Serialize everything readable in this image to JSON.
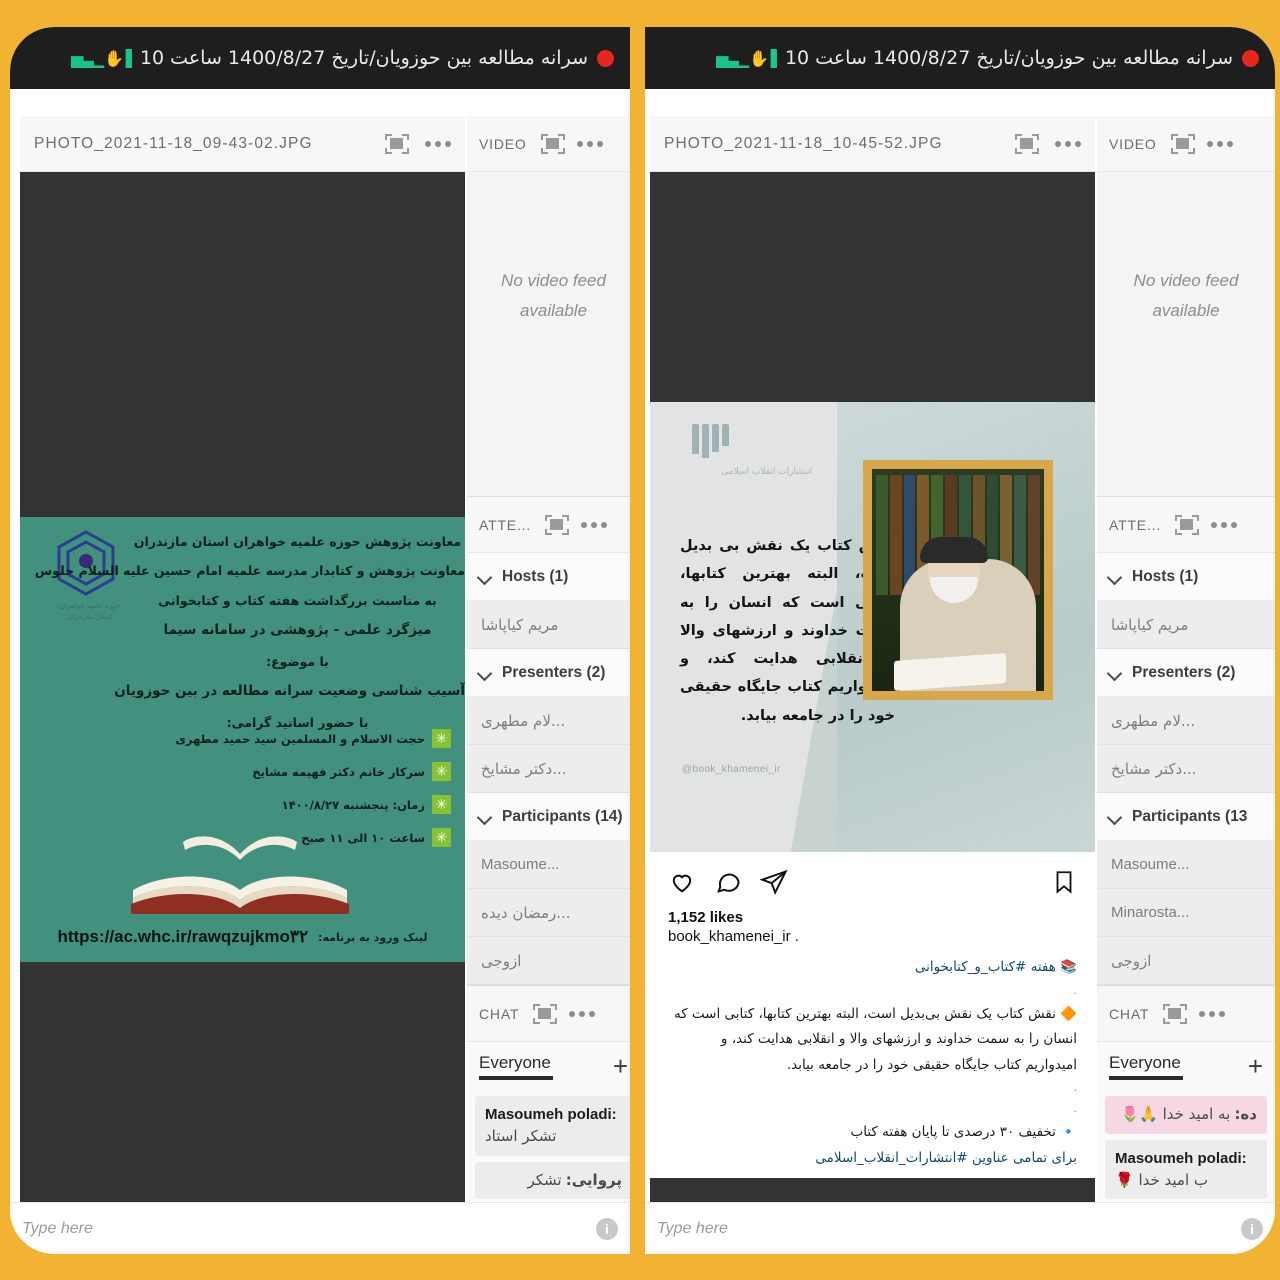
{
  "frame": {
    "border_color": "#f2b332"
  },
  "panels": [
    {
      "id": "left",
      "topbar": {
        "recording": true,
        "title": "سرانه مطالعه بین حوزویان/تاریخ 1400/8/27 ساعت 10"
      },
      "share_pod": {
        "title": "PHOTO_2021-11-18_09-43-02.JPG"
      },
      "video_pod": {
        "title": "VIDEO",
        "empty_message_line1": "No video feed",
        "empty_message_line2": "available"
      },
      "attendees_pod": {
        "title": "ATTE...",
        "groups": [
          {
            "label": "Hosts (1)",
            "members": [
              "مریم کیاپاشا"
            ]
          },
          {
            "label": "Presenters (2)",
            "members": [
              "...لام مطهری",
              "...دکتر مشایخ"
            ]
          },
          {
            "label": "Participants (14)",
            "members": [
              "Masoume...",
              "...رمضان دیده",
              "ازوجی"
            ]
          }
        ]
      },
      "chat_pod": {
        "title": "CHAT",
        "tab": "Everyone",
        "add_label": "+",
        "messages": [
          {
            "author": "Masoumeh poladi:",
            "text": "تشکر استاد",
            "highlight": false
          },
          {
            "author": "پروایی:",
            "text": "تشکر",
            "highlight": false
          }
        ],
        "composer_placeholder": "Type here",
        "composer_badge": "i"
      },
      "poster": {
        "type": "green-flyer",
        "lines": [
          "معاونت پژوهش حوزه علمیه خواهران استان مازندران",
          "معاونت پژوهش و کتابدار مدرسه علمیه امام حسین علیه السلام جلوس",
          "به مناسبت بزرگداشت هفته کتاب و کتابخوانی",
          "میزگرد علمی - پژوهشی در سامانه سیما",
          "با موضوع:",
          "آسیب شناسی وضعیت سرانه مطالعه در بین حوزویان",
          "با حضور اساتید گرامی:"
        ],
        "bullets": [
          "حجت الاسلام و المسلمین سید حمید مطهری",
          "سرکار خانم دکتر فهیمه مشایخ",
          "زمان: پنجشنبه ۱۴۰۰/۸/۲۷",
          "ساعت ۱۰ الی ۱۱ صبح"
        ],
        "footer_label": "لینک ورود به برنامه:",
        "url": "https://ac.whc.ir/rawqzujkmo۳۲"
      }
    },
    {
      "id": "right",
      "topbar": {
        "recording": true,
        "title": "سرانه مطالعه بین حوزویان/تاریخ 1400/8/27 ساعت 10"
      },
      "share_pod": {
        "title": "PHOTO_2021-11-18_10-45-52.JPG"
      },
      "video_pod": {
        "title": "VIDEO",
        "empty_message_line1": "No video feed",
        "empty_message_line2": "available"
      },
      "attendees_pod": {
        "title": "ATTE...",
        "groups": [
          {
            "label": "Hosts (1)",
            "members": [
              "مریم کیاپاشا"
            ]
          },
          {
            "label": "Presenters (2)",
            "members": [
              "...لام مطهری",
              "...دکتر مشایخ"
            ]
          },
          {
            "label": "Participants (13",
            "members": [
              "Masoume...",
              "Minarosta...",
              "ازوجی"
            ]
          }
        ]
      },
      "chat_pod": {
        "title": "CHAT",
        "tab": "Everyone",
        "add_label": "+",
        "messages": [
          {
            "author": "ده:",
            "text": "به امید خدا 🙏🌷",
            "highlight": true
          },
          {
            "author": "Masoumeh poladi:",
            "text": "ب امید خدا 🌹",
            "highlight": false
          }
        ],
        "composer_placeholder": "Type here",
        "composer_badge": "i"
      },
      "instagram": {
        "poster_quote": "نقش کتاب یک نقش بی بدیل است، البته بهترین کتابها، کتابی است که انسان را به سمت خداوند و ارزشهای والا و انقلابی هدایت کند، و امیدواریم کتاب جایگاه حقیقی خود را در جامعه بیابد.",
        "poster_handle": "@book_khamenei_ir",
        "likes": "1,152 likes",
        "username": "book_khamenei_ir",
        "username_suffix": ".",
        "caption_tag_line": "📚 هفته #کتاب_و_کتابخوانی",
        "caption_body": "🔶 نقش کتاب یک نقش بی‌بدیل است، البته بهترین کتابها، کتابی است که انسان را به سمت خداوند و ارزشهای والا و انقلابی هدایت کند، و امیدواریم کتاب جایگاه حقیقی خود را در جامعه بیابد.",
        "caption_promo_line1": "🔹 تخفیف ۳۰ درصدی تا پایان هفته کتاب",
        "caption_promo_line2": "برای تمامی عناوین #انتشارات_انقلاب_اسلامی",
        "dot1": ".",
        "dot2": ".",
        "dot3": ".",
        "actions": [
          "heart-icon",
          "comment-icon",
          "share-icon",
          "bookmark-icon"
        ]
      }
    }
  ]
}
